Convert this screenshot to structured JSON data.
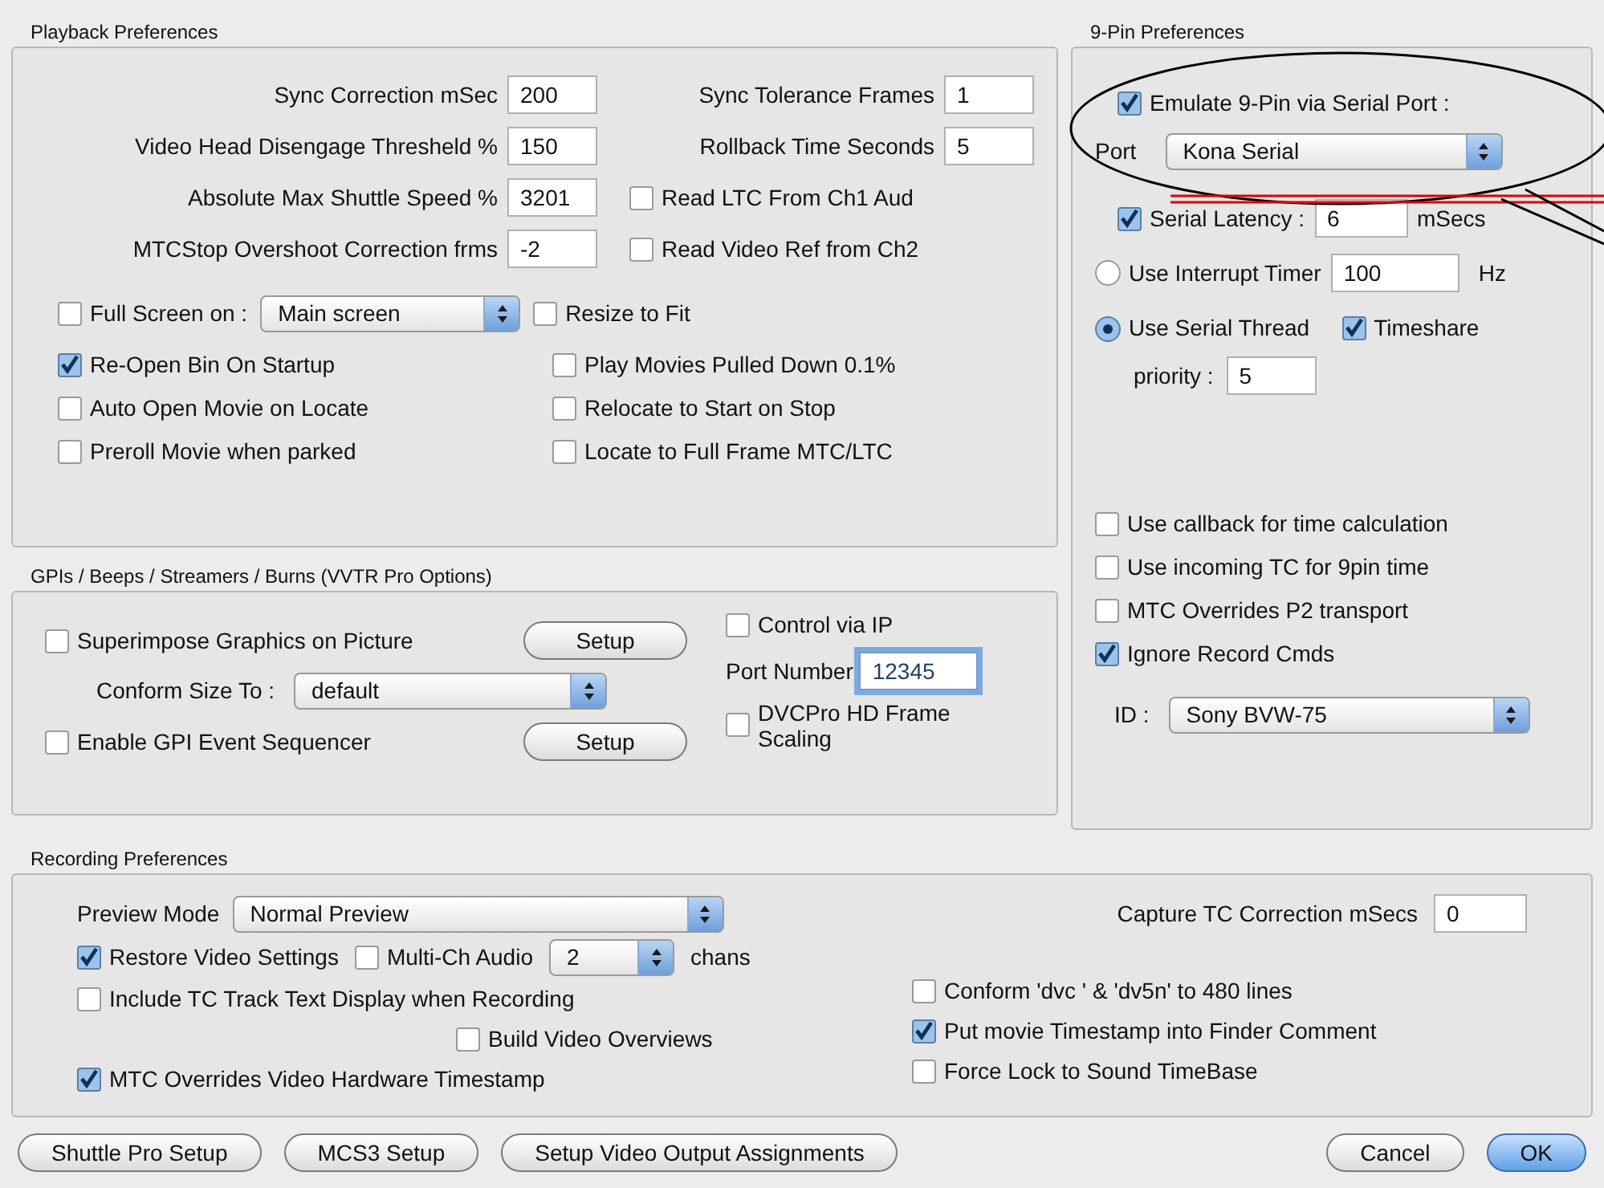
{
  "playback": {
    "title": "Playback Preferences",
    "rows": [
      {
        "left": {
          "label": "Sync Correction mSec",
          "value": "200"
        },
        "right": {
          "kind": "field",
          "label": "Sync Tolerance Frames",
          "value": "1"
        }
      },
      {
        "left": {
          "label": "Video Head Disengage Thresheld %",
          "value": "150"
        },
        "right": {
          "kind": "field",
          "label": "Rollback Time Seconds",
          "value": "5"
        }
      },
      {
        "left": {
          "label": "Absolute Max Shuttle Speed %",
          "value": "3201"
        },
        "right": {
          "kind": "checkbox",
          "label": "Read LTC From Ch1 Aud",
          "checked": false
        }
      },
      {
        "left": {
          "label": "MTCStop Overshoot Correction frms",
          "value": "-2"
        },
        "right": {
          "kind": "checkbox",
          "label": "Read Video Ref from Ch2",
          "checked": false
        }
      }
    ],
    "full_screen": {
      "label": "Full Screen on :",
      "checked": false,
      "select": "Main screen"
    },
    "resize": {
      "label": "Resize to Fit",
      "checked": false
    },
    "options_left": [
      {
        "label": "Re-Open Bin On Startup",
        "checked": true
      },
      {
        "label": "Auto Open Movie on Locate",
        "checked": false
      },
      {
        "label": "Preroll Movie when parked",
        "checked": false
      }
    ],
    "options_right": [
      {
        "label": "Play Movies Pulled Down 0.1%",
        "checked": false
      },
      {
        "label": "Relocate to Start on Stop",
        "checked": false
      },
      {
        "label": "Locate to Full Frame MTC/LTC",
        "checked": false
      }
    ]
  },
  "gpi": {
    "title": "GPIs / Beeps / Streamers / Burns (VVTR Pro Options)",
    "superimpose": {
      "label": "Superimpose Graphics on Picture",
      "checked": false,
      "button": "Setup"
    },
    "conform": {
      "label": "Conform Size To :",
      "select": "default"
    },
    "sequencer": {
      "label": "Enable GPI Event Sequencer",
      "checked": false,
      "button": "Setup"
    },
    "control_ip": {
      "label": "Control via IP",
      "checked": false
    },
    "port": {
      "label": "Port Number",
      "value": "12345",
      "focused": true
    },
    "dvcpro": {
      "label": "DVCPro HD Frame Scaling",
      "checked": false
    }
  },
  "ninepin": {
    "title": "9-Pin Preferences",
    "emulate": {
      "label": "Emulate 9-Pin via Serial Port :",
      "checked": true
    },
    "port": {
      "label": "Port",
      "select": "Kona Serial"
    },
    "latency": {
      "label": "Serial Latency :",
      "checked": true,
      "value": "6",
      "unit": "mSecs"
    },
    "interrupt": {
      "label": "Use Interrupt Timer",
      "selected": false,
      "value": "100",
      "unit": "Hz"
    },
    "thread": {
      "label": "Use Serial Thread",
      "selected": true
    },
    "timeshare": {
      "label": "Timeshare",
      "checked": true
    },
    "priority": {
      "label": "priority :",
      "value": "5"
    },
    "options": [
      {
        "label": "Use callback for time calculation",
        "checked": false
      },
      {
        "label": "Use incoming TC for 9pin time",
        "checked": false
      },
      {
        "label": "MTC Overrides P2 transport",
        "checked": false
      },
      {
        "label": "Ignore Record Cmds",
        "checked": true
      }
    ],
    "id": {
      "label": "ID :",
      "select": "Sony BVW-75"
    }
  },
  "recording": {
    "title": "Recording Preferences",
    "preview": {
      "label": "Preview Mode",
      "select": "Normal Preview"
    },
    "capture": {
      "label": "Capture TC Correction mSecs",
      "value": "0"
    },
    "restore": {
      "label": "Restore Video Settings",
      "checked": true
    },
    "multich": {
      "label": "Multi-Ch Audio",
      "checked": false,
      "select": "2",
      "unit": "chans"
    },
    "include_tc": {
      "label": "Include TC Track Text Display when Recording",
      "checked": false
    },
    "overviews": {
      "label": "Build Video Overviews",
      "checked": false
    },
    "mtc": {
      "label": "MTC Overrides Video Hardware Timestamp",
      "checked": true
    },
    "options_right": [
      {
        "label": "Conform 'dvc ' & 'dv5n' to 480 lines",
        "checked": false
      },
      {
        "label": "Put movie Timestamp into Finder Comment",
        "checked": true
      },
      {
        "label": "Force Lock to Sound TimeBase",
        "checked": false
      }
    ]
  },
  "buttons": [
    {
      "label": "Shuttle Pro Setup",
      "default": false
    },
    {
      "label": "MCS3 Setup",
      "default": false
    },
    {
      "label": "Setup Video Output Assignments",
      "default": false
    },
    {
      "label": "Cancel",
      "default": false
    },
    {
      "label": "OK",
      "default": true
    }
  ]
}
